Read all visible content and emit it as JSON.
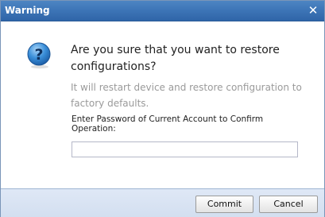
{
  "dialog": {
    "title": "Warning",
    "close_symbol": "✕",
    "icon": "question-icon",
    "message": "Are you sure that you want to restore configurations?",
    "detail": "It will restart device and restore configuration to factory defaults.",
    "password_label": "Enter Password of Current Account to Confirm Operation:",
    "password_value": "",
    "buttons": {
      "commit": "Commit",
      "cancel": "Cancel"
    }
  },
  "colors": {
    "titlebar": "#3c74b6",
    "footer": "#dfe8f6",
    "detail_text": "#9a9a9a"
  }
}
